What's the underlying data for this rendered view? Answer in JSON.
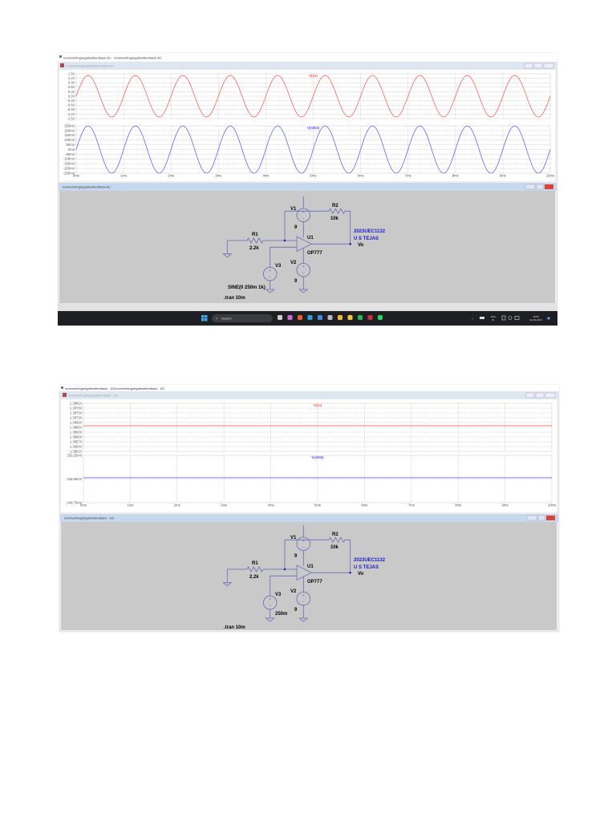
{
  "screenshot_ac": {
    "tabs": [
      "noninvertingnegativefeedback.AC",
      "noninvertingnegativefeedback.AC"
    ],
    "plot_window_title": "noninvertingnegativefeedback.AC",
    "schematic_window_title": "noninvertingnegativefeedback.AC",
    "schematic": {
      "v1": "V1",
      "v1_value": "9",
      "v2": "V2",
      "v2_value": "9",
      "r1": "R1",
      "r1_value": "2.2k",
      "r2": "R2",
      "r2_value": "10k",
      "u1": "U1",
      "u1_model": "OP777",
      "v3": "V3",
      "v3_value": "SINE(0 250m 1k)",
      "output_net": "Vo",
      "author_id": "2023UEC1132",
      "author_name": "U S TEJAS",
      "directive": ".tran 10m"
    },
    "taskbar": {
      "search_placeholder": "Search",
      "language": "ENG",
      "region": "IN",
      "time": "18:55",
      "date": "21-08-2024"
    }
  },
  "screenshot_dc": {
    "tabs": [
      "noninvertingnegativefeedback - DC",
      "noninvertingnegativefeedback - DC"
    ],
    "plot_window_title": "noninvertingnegativefeedback - DC",
    "schematic_window_title": "noninvertingnegativefeedback - DC",
    "schematic": {
      "v1": "V1",
      "v1_value": "9",
      "v2": "V2",
      "v2_value": "9",
      "r1": "R1",
      "r1_value": "2.2k",
      "r2": "R2",
      "r2_value": "10k",
      "u1": "U1",
      "u1_model": "OP777",
      "v3": "V3",
      "v3_value": "250m",
      "output_net": "Vo",
      "author_id": "2023UEC1132",
      "author_name": "U S TEJAS",
      "directive": ".tran 10m"
    }
  },
  "chart_data": [
    {
      "type": "line",
      "title": "AC transient",
      "xlim": [
        0,
        10
      ],
      "xunit": "ms",
      "xticks": [
        "0ms",
        "1ms",
        "2ms",
        "3ms",
        "4ms",
        "5ms",
        "6ms",
        "7ms",
        "8ms",
        "9ms",
        "10ms"
      ],
      "grid": true,
      "panes": [
        {
          "name": "V(vo)",
          "color": "#ff5050",
          "ylim": [
            -1.5,
            1.5
          ],
          "yticks": [
            "1.5V",
            "1.2V",
            "0.9V",
            "0.6V",
            "0.3V",
            "0.0V",
            "-0.3V",
            "-0.6V",
            "-0.9V",
            "-1.2V",
            "-1.5V"
          ],
          "waveform": {
            "type": "sine",
            "offset": 0,
            "amplitude": 1.386,
            "frequency_khz": 1
          }
        },
        {
          "name": "V(n003)",
          "color": "#5050ff",
          "ylim": [
            -250,
            250
          ],
          "yticks": [
            "250mV",
            "200mV",
            "150mV",
            "100mV",
            "50mV",
            "0mV",
            "-50mV",
            "-100mV",
            "-150mV",
            "-200mV",
            "-250mV"
          ],
          "waveform": {
            "type": "sine",
            "offset": 0,
            "amplitude": 250,
            "frequency_khz": 1
          }
        }
      ]
    },
    {
      "type": "line",
      "title": "DC transient",
      "xlim": [
        0,
        10
      ],
      "xunit": "ms",
      "xticks": [
        "0ms",
        "1ms",
        "2ms",
        "3ms",
        "4ms",
        "5ms",
        "6ms",
        "7ms",
        "8ms",
        "9ms",
        "10ms"
      ],
      "grid": true,
      "panes": [
        {
          "name": "V(vo)",
          "color": "#ff5050",
          "ylim": [
            1.3851,
            1.3881
          ],
          "yticks": [
            "1.3881V",
            "1.3878V",
            "1.3875V",
            "1.3872V",
            "1.3869V",
            "1.3866V",
            "1.3863V",
            "1.3860V",
            "1.3857V",
            "1.3854V",
            "1.3851V"
          ],
          "waveform": {
            "type": "constant",
            "offset": 1.3867
          }
        },
        {
          "name": "V(n003)",
          "color": "#5050ff",
          "ylim": [
            249.7,
            250.25
          ],
          "yticks": [
            "250.25mV",
            "249.98mV",
            "249.70mV"
          ],
          "waveform": {
            "type": "constant",
            "offset": 249.99
          }
        }
      ]
    }
  ]
}
